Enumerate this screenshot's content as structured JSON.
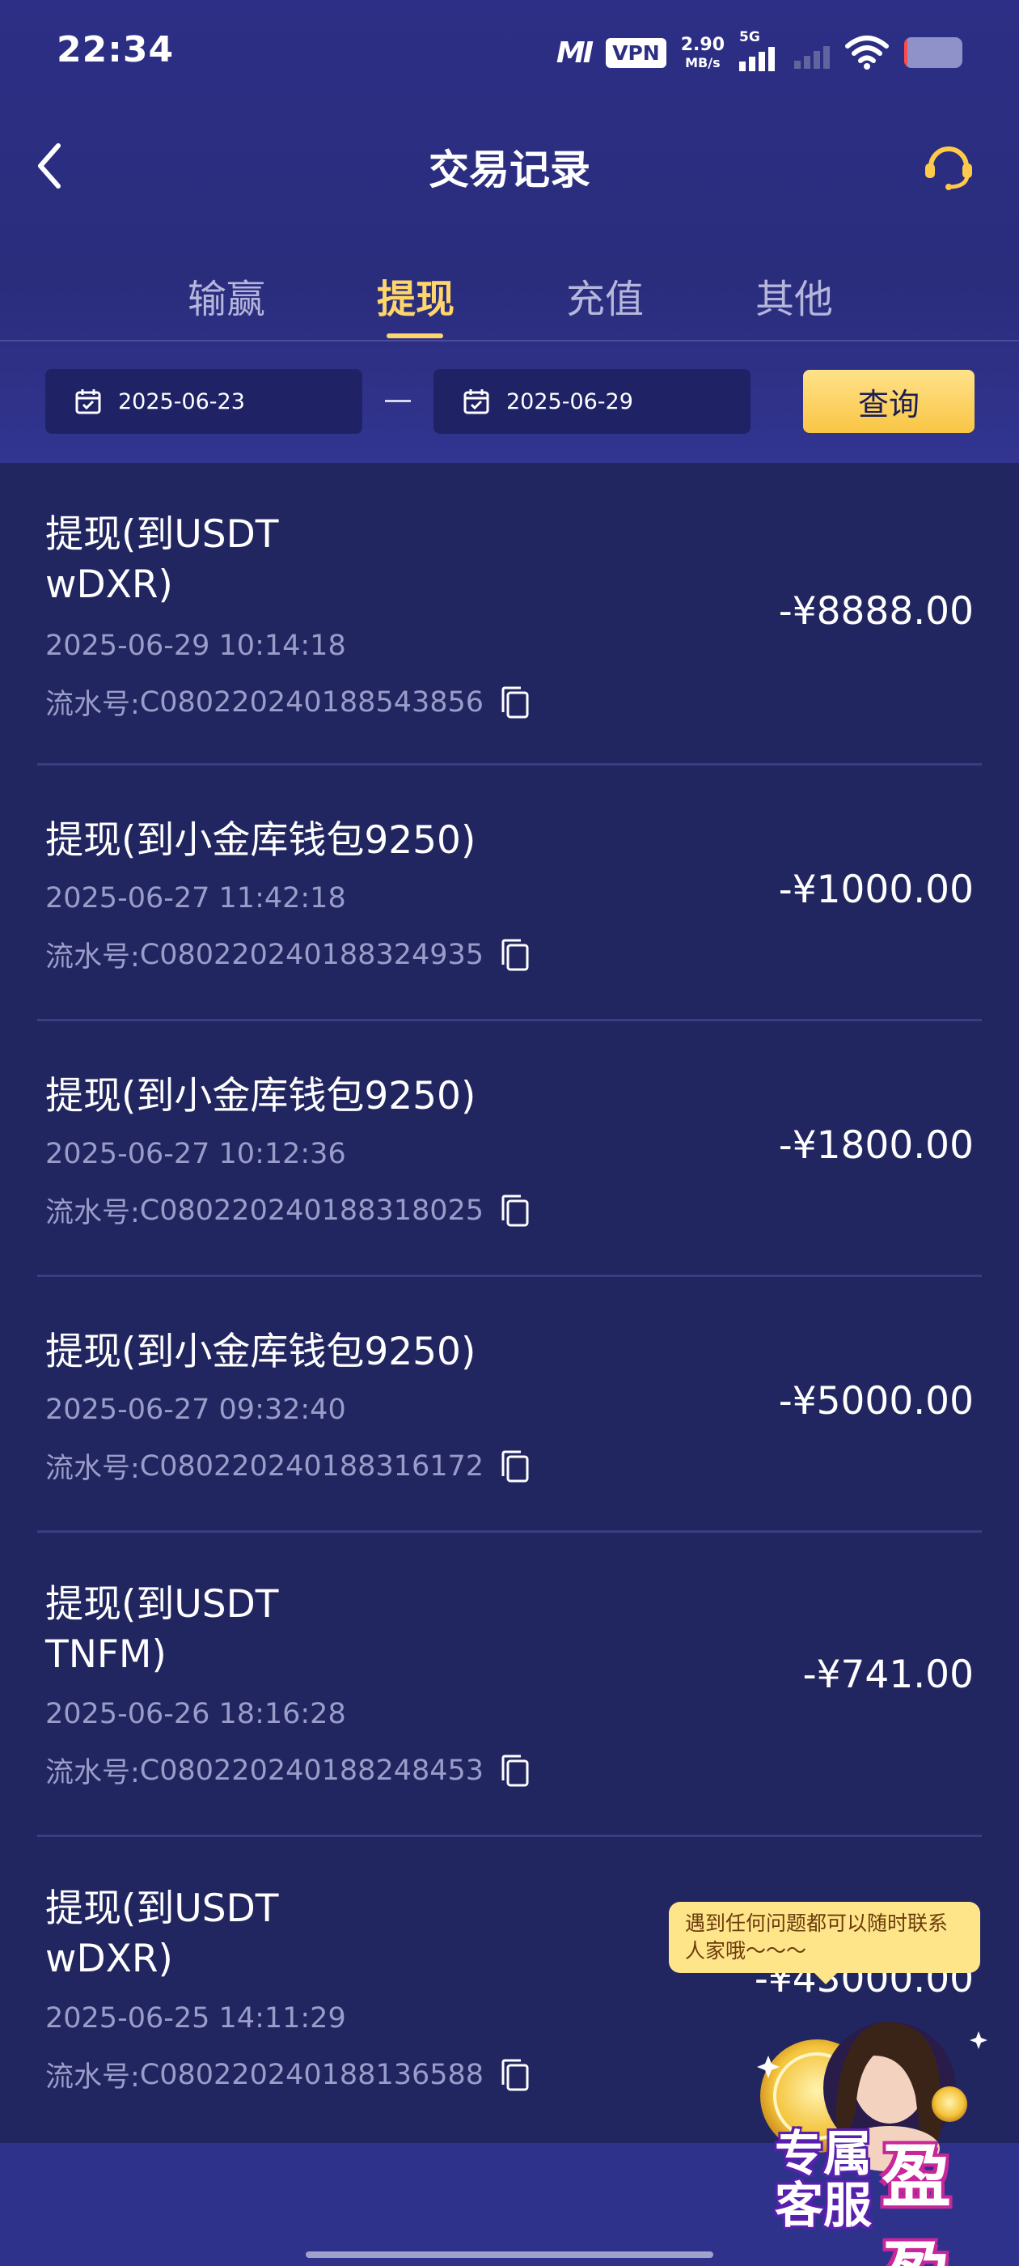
{
  "status_bar": {
    "time": "22:34",
    "brand_mark": "MI",
    "vpn": "VPN",
    "speed_value": "2.90",
    "speed_unit": "MB/s",
    "network": "5G",
    "battery_level": 0.06
  },
  "nav": {
    "title": "交易记录",
    "back_icon": "chevron-left-icon",
    "support_icon": "headset-icon"
  },
  "tabs": [
    {
      "label": "输赢",
      "active": false
    },
    {
      "label": "提现",
      "active": true
    },
    {
      "label": "充值",
      "active": false
    },
    {
      "label": "其他",
      "active": false
    }
  ],
  "filter": {
    "start_date": "2025-06-23",
    "end_date": "2025-06-29",
    "query_label": "查询",
    "calendar_icon": "calendar-icon"
  },
  "records": [
    {
      "title": "提现(到USDT wDXR)",
      "title_line1": "提现(到USDT",
      "title_line2": "wDXR)",
      "time": "2025-06-29 10:14:18",
      "serial_label": "流水号:",
      "serial": "C080220240188543856",
      "amount": "-¥8888.00"
    },
    {
      "title": "提现(到小金库钱包9250)",
      "title_line1": "提现(到小金库钱包9250)",
      "title_line2": "",
      "time": "2025-06-27 11:42:18",
      "serial_label": "流水号:",
      "serial": "C080220240188324935",
      "amount": "-¥1000.00"
    },
    {
      "title": "提现(到小金库钱包9250)",
      "title_line1": "提现(到小金库钱包9250)",
      "title_line2": "",
      "time": "2025-06-27 10:12:36",
      "serial_label": "流水号:",
      "serial": "C080220240188318025",
      "amount": "-¥1800.00"
    },
    {
      "title": "提现(到小金库钱包9250)",
      "title_line1": "提现(到小金库钱包9250)",
      "title_line2": "",
      "time": "2025-06-27 09:32:40",
      "serial_label": "流水号:",
      "serial": "C080220240188316172",
      "amount": "-¥5000.00"
    },
    {
      "title": "提现(到USDT TNFM)",
      "title_line1": "提现(到USDT",
      "title_line2": "TNFM)",
      "time": "2025-06-26 18:16:28",
      "serial_label": "流水号:",
      "serial": "C080220240188248453",
      "amount": "-¥741.00"
    },
    {
      "title": "提现(到USDT wDXR)",
      "title_line1": "提现(到USDT",
      "title_line2": "wDXR)",
      "time": "2025-06-25 14:11:29",
      "serial_label": "流水号:",
      "serial": "C080220240188136588",
      "amount": "-¥43000.00"
    }
  ],
  "support_widget": {
    "bubble_text": "遇到任何问题都可以随时联系人家哦～～～",
    "label_line1": "专属",
    "label_line2": "客服",
    "label_name": "盈盈"
  }
}
